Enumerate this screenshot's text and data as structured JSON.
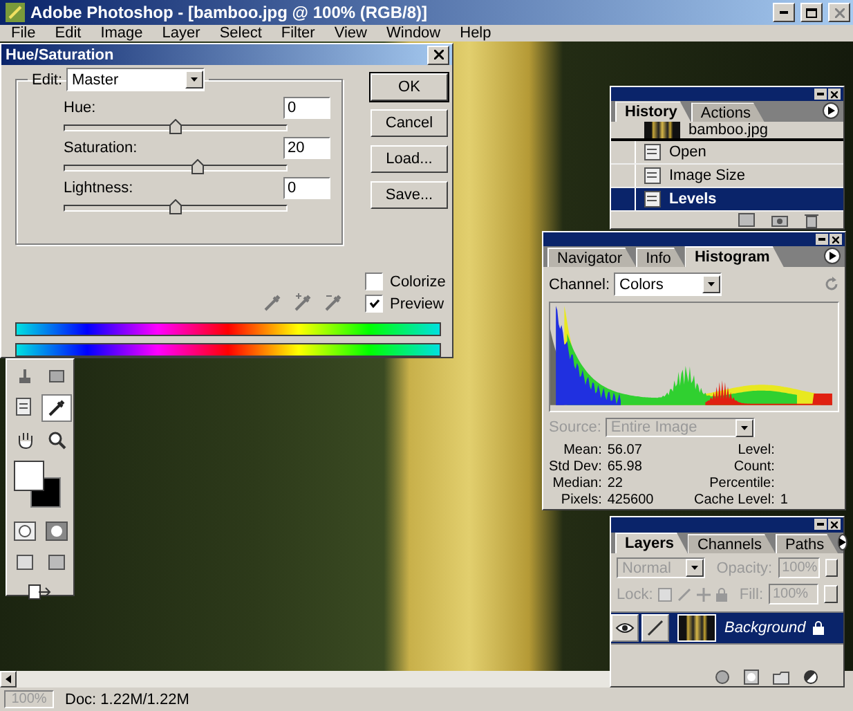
{
  "window": {
    "title": "Adobe Photoshop - [bamboo.jpg @ 100% (RGB/8)]"
  },
  "menu": [
    "File",
    "Edit",
    "Image",
    "Layer",
    "Select",
    "Filter",
    "View",
    "Window",
    "Help"
  ],
  "dialog": {
    "title": "Hue/Saturation",
    "edit_label": "Edit:",
    "edit_value": "Master",
    "sliders": [
      {
        "label": "Hue:",
        "value": "0",
        "level": 0.5
      },
      {
        "label": "Saturation:",
        "value": "20",
        "level": 0.6
      },
      {
        "label": "Lightness:",
        "value": "0",
        "level": 0.5
      }
    ],
    "buttons": [
      "OK",
      "Cancel",
      "Load...",
      "Save..."
    ],
    "checkboxes": [
      {
        "label": "Colorize",
        "checked": false
      },
      {
        "label": "Preview",
        "checked": true
      }
    ]
  },
  "history": {
    "tabs": [
      {
        "label": "History",
        "selected": true
      },
      {
        "label": "Actions",
        "selected": false
      }
    ],
    "snapshot": "bamboo.jpg",
    "items": [
      {
        "label": "Open",
        "selected": false
      },
      {
        "label": "Image Size",
        "selected": false
      },
      {
        "label": "Levels",
        "selected": true
      }
    ]
  },
  "histogram": {
    "tabs": [
      {
        "label": "Navigator",
        "selected": false
      },
      {
        "label": "Info",
        "selected": false
      },
      {
        "label": "Histogram",
        "selected": true
      }
    ],
    "channel_label": "Channel:",
    "channel": "Colors",
    "source": {
      "label": "Source:",
      "value": "Entire Image",
      "disabled": true
    },
    "stats_left": [
      {
        "label": "Mean:",
        "value": "56.07"
      },
      {
        "label": "Std Dev:",
        "value": "65.98"
      },
      {
        "label": "Median:",
        "value": "22"
      },
      {
        "label": "Pixels:",
        "value": "425600"
      }
    ],
    "stats_right": [
      {
        "label": "Level:"
      },
      {
        "label": "Count:"
      },
      {
        "label": "Percentile:"
      },
      {
        "label": "Cache Level:",
        "value": "1"
      }
    ]
  },
  "layers": {
    "tabs": [
      {
        "label": "Layers",
        "selected": true
      },
      {
        "label": "Channels",
        "selected": false
      },
      {
        "label": "Paths",
        "selected": false
      }
    ],
    "blend_mode": {
      "value": "Normal",
      "disabled": true
    },
    "opacity": {
      "label": "Opacity:",
      "value": "100%",
      "disabled": true
    },
    "lock_label": "Lock:",
    "fill": {
      "label": "Fill:",
      "value": "100%",
      "disabled": true
    },
    "items": [
      {
        "name": "Background",
        "visible": true,
        "selected": true,
        "locked": true
      }
    ]
  },
  "status_bar": {
    "zoom": "100%",
    "doc": "Doc: 1.22M/1.22M"
  }
}
